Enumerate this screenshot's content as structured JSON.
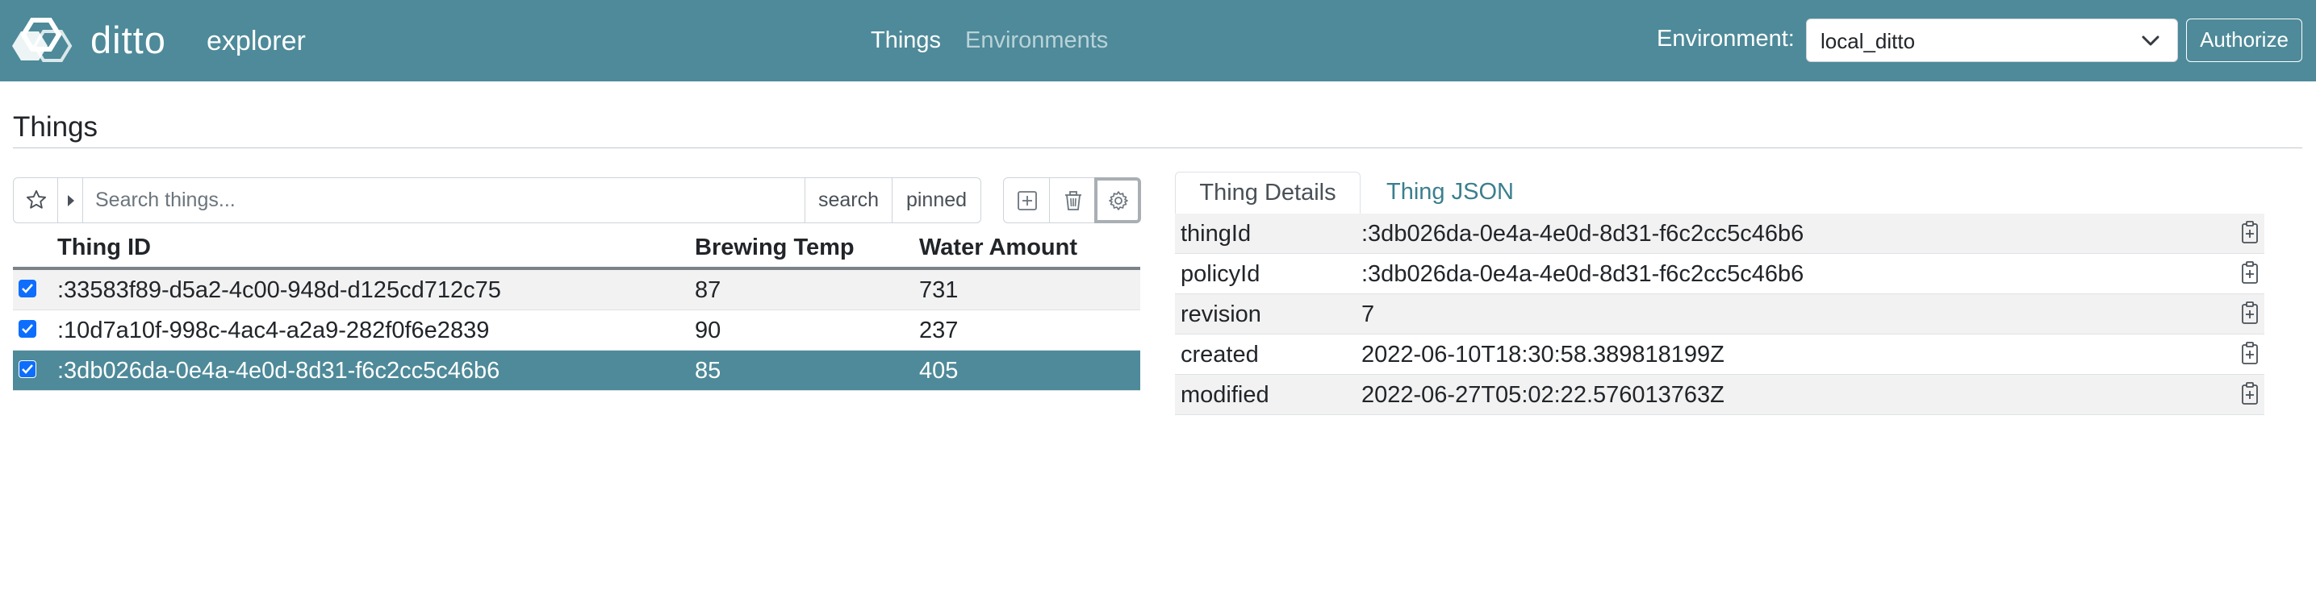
{
  "app": {
    "brand": "ditto",
    "subtitle": "explorer"
  },
  "nav": {
    "things": "Things",
    "environments": "Environments"
  },
  "environment": {
    "label": "Environment:",
    "selected": "local_ditto",
    "authorize_label": "Authorize"
  },
  "page": {
    "title": "Things"
  },
  "search": {
    "placeholder": "Search things...",
    "search_label": "search",
    "pinned_label": "pinned"
  },
  "table": {
    "columns": [
      "Thing ID",
      "Brewing Temp",
      "Water Amount"
    ],
    "rows": [
      {
        "id": ":33583f89-d5a2-4c00-948d-d125cd712c75",
        "temp": "87",
        "water": "731",
        "checked": true,
        "selected": false
      },
      {
        "id": ":10d7a10f-998c-4ac4-a2a9-282f0f6e2839",
        "temp": "90",
        "water": "237",
        "checked": true,
        "selected": false
      },
      {
        "id": ":3db026da-0e4a-4e0d-8d31-f6c2cc5c46b6",
        "temp": "85",
        "water": "405",
        "checked": true,
        "selected": true
      }
    ]
  },
  "details": {
    "tabs": [
      "Thing Details",
      "Thing JSON"
    ],
    "active_tab": "Thing Details",
    "rows": [
      {
        "key": "thingId",
        "value": ":3db026da-0e4a-4e0d-8d31-f6c2cc5c46b6"
      },
      {
        "key": "policyId",
        "value": ":3db026da-0e4a-4e0d-8d31-f6c2cc5c46b6"
      },
      {
        "key": "revision",
        "value": "7"
      },
      {
        "key": "created",
        "value": "2022-06-10T18:30:58.389818199Z"
      },
      {
        "key": "modified",
        "value": "2022-06-27T05:02:22.576013763Z"
      }
    ]
  },
  "icons": {
    "logo": "ditto-hexagon-logo",
    "favorite": "star-icon",
    "expand": "caret-right-icon",
    "add": "plus-square-icon",
    "delete": "trash-icon",
    "settings": "gear-icon",
    "copy": "clipboard-plus-icon",
    "dropdown": "chevron-down-icon"
  },
  "colors": {
    "brand": "#4e8a99",
    "selected_row": "#4e8a99",
    "checkbox": "#0d6efd",
    "link": "#3b7f8e"
  }
}
